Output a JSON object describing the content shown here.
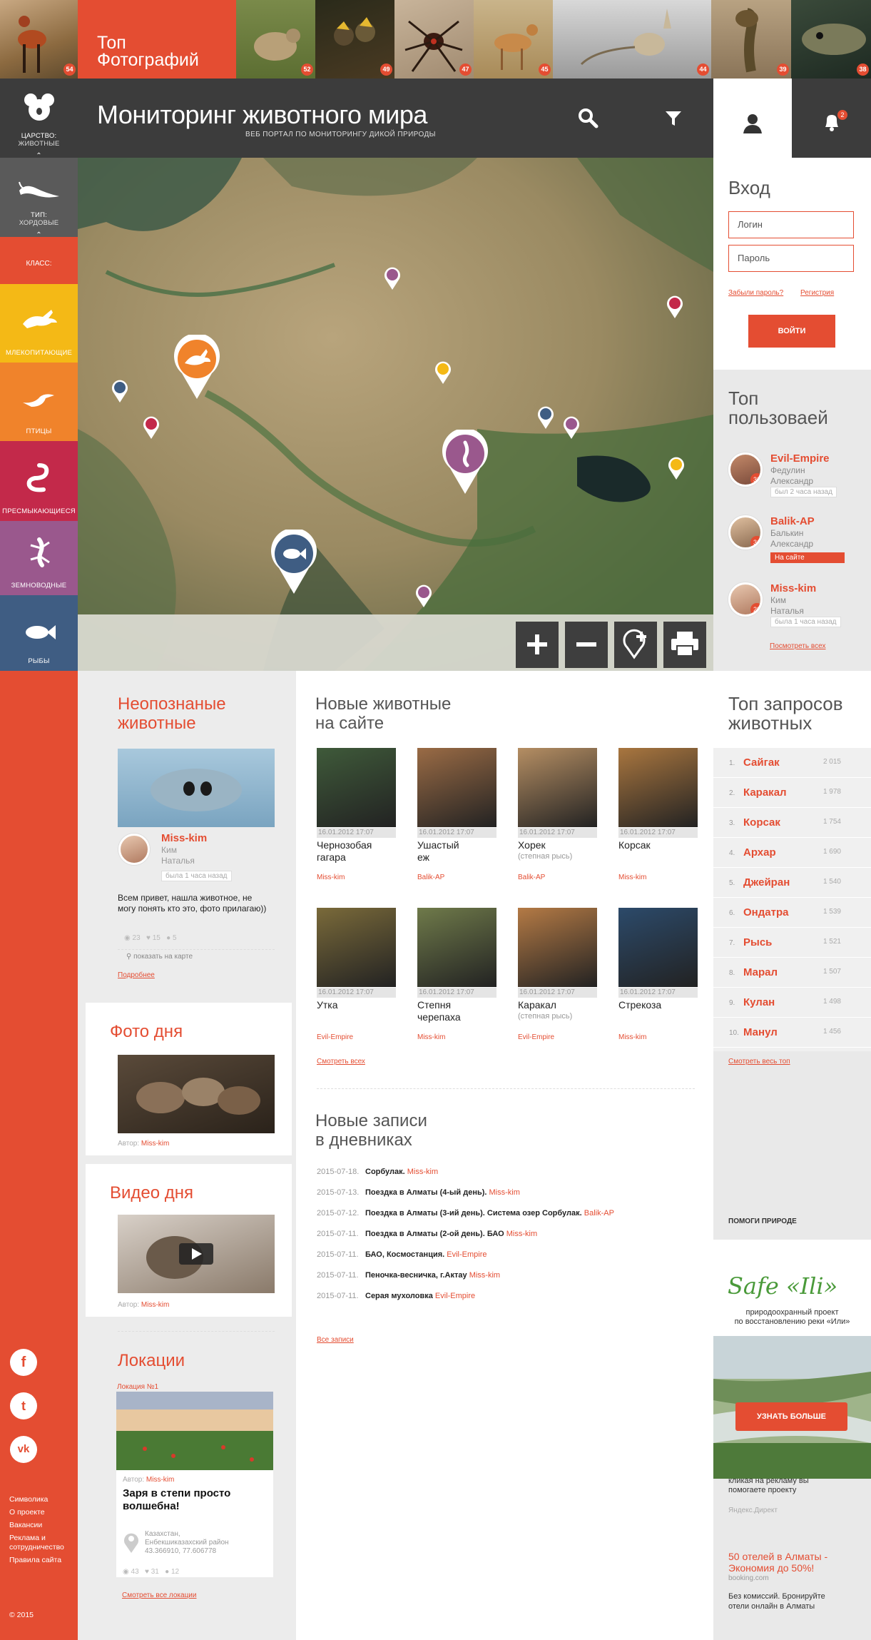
{
  "top_photos": {
    "title_line1": "Топ",
    "title_line2": "Фотографий",
    "counts": [
      "54",
      "52",
      "49",
      "47",
      "45",
      "44",
      "39",
      "38"
    ]
  },
  "nav": {
    "kingdom_label": "ЦАРСТВО:",
    "kingdom_value": "ЖИВОТНЫЕ",
    "type_label": "ТИП:",
    "type_value": "ХОРДОВЫЕ",
    "class_label": "КЛАСС:",
    "classes": [
      {
        "label": "МЛЕКОПИТАЮЩИЕ",
        "color": "#f4b916"
      },
      {
        "label": "ПТИЦЫ",
        "color": "#f0832b"
      },
      {
        "label": "ПРЕСМЫКАЮЩИЕСЯ",
        "color": "#c3294a"
      },
      {
        "label": "ЗЕМНОВОДНЫЕ",
        "color": "#9a588d"
      },
      {
        "label": "РЫБЫ",
        "color": "#3f5d83"
      }
    ]
  },
  "header": {
    "title": "Мониторинг животного мира",
    "subtitle": "ВЕБ ПОРТАЛ ПО МОНИТОРИНГУ ДИКОЙ ПРИРОДЫ",
    "notif_count": "2"
  },
  "login": {
    "title": "Вход",
    "login_placeholder": "Логин",
    "password_placeholder": "Пароль",
    "forgot": "Забыли пароль?",
    "register": "Регистрия",
    "submit": "ВОЙТИ"
  },
  "top_users": {
    "title_line1": "Топ",
    "title_line2": "пользоваей",
    "users": [
      {
        "nick": "Evil-Empire",
        "last": "Федулин",
        "first": "Александр",
        "score": "32",
        "status": "был 2 часа назад"
      },
      {
        "nick": "Balik-AP",
        "last": "Балькин",
        "first": "Александр",
        "score": "31",
        "status": "На сайте"
      },
      {
        "nick": "Miss-kim",
        "last": "Ким",
        "first": "Наталья",
        "score": "28",
        "status": "была 1 часа назад"
      }
    ],
    "all_link": "Посмотреть всех"
  },
  "top_queries": {
    "title_line1": "Топ запросов",
    "title_line2": "животных",
    "rows": [
      {
        "n": "1.",
        "q": "Сайгак",
        "c": "2 015"
      },
      {
        "n": "2.",
        "q": "Каракал",
        "c": "1 978"
      },
      {
        "n": "3.",
        "q": "Корсак",
        "c": "1 754"
      },
      {
        "n": "4.",
        "q": "Архар",
        "c": "1 690"
      },
      {
        "n": "5.",
        "q": "Джейран",
        "c": "1 540"
      },
      {
        "n": "6.",
        "q": "Ондатра",
        "c": "1 539"
      },
      {
        "n": "7.",
        "q": "Рысь",
        "c": "1 521"
      },
      {
        "n": "8.",
        "q": "Марал",
        "c": "1 507"
      },
      {
        "n": "9.",
        "q": "Кулан",
        "c": "1 498"
      },
      {
        "n": "10.",
        "q": "Манул",
        "c": "1 456"
      }
    ],
    "all_link": "Смотреть весь топ"
  },
  "help": {
    "label": "ПОМОГИ ПРИРОДЕ",
    "brand": "Safe «Ili»",
    "desc_line1": "природоохранный проект",
    "desc_line2": "по восстановлению реки «Или»",
    "button": "УЗНАТЬ БОЛЬШЕ"
  },
  "ads": {
    "note_line1": "кликая на рекламу вы",
    "note_line2": "помогаете проекту",
    "provider": "Яндекс.Директ",
    "ad_title_line1": "50 отелей в Алматы -",
    "ad_title_line2": "Экономия до 50%!",
    "ad_domain": "booking.com",
    "ad_text_line1": "Без комиссий. Бронируйте",
    "ad_text_line2": "отели онлайн в Алматы"
  },
  "unidentified": {
    "title_line1": "Неопознаные",
    "title_line2": "животные",
    "user": "Miss-kim",
    "last": "Ким",
    "first": "Наталья",
    "status": "была 1 часа назад",
    "text": "Всем привет, нашла животное, не могу понять кто это, фото прилагаю))",
    "views": "23",
    "likes": "15",
    "comments": "5",
    "map_link": "показать на карте",
    "more": "Подробнее"
  },
  "photo_day": {
    "title": "Фото дня",
    "author_label": "Автор:",
    "author": "Miss-kim"
  },
  "video_day": {
    "title": "Видео дня",
    "author_label": "Автор:",
    "author": "Miss-kim"
  },
  "locations": {
    "title": "Локации",
    "item_label": "Локация №1",
    "author_label": "Автор:",
    "author": "Miss-kim",
    "headline_line1": "Заря в степи просто",
    "headline_line2": "волшебна!",
    "place_line1": "Казахстан,",
    "place_line2": "Енбекшиказахский район",
    "coords": "43.366910, 77.606778",
    "views": "43",
    "likes": "31",
    "comments": "12",
    "all_link": "Смотреть все локации"
  },
  "new_animals": {
    "title_line1": "Новые животные",
    "title_line2": "на сайте",
    "items": [
      {
        "date": "16.01.2012 17:07",
        "name1": "Чернозобая",
        "name2": "гагара",
        "sub": "",
        "author": "Miss-kim",
        "bg": "#3f5a3a"
      },
      {
        "date": "16.01.2012 17:07",
        "name1": "Ушастый",
        "name2": "еж",
        "sub": "",
        "author": "Balik-AP",
        "bg": "#9a6b45"
      },
      {
        "date": "16.01.2012 17:07",
        "name1": "Хорек",
        "name2": "",
        "sub": "(степная рысь)",
        "author": "Balik-AP",
        "bg": "#b58e63"
      },
      {
        "date": "16.01.2012 17:07",
        "name1": "Корсак",
        "name2": "",
        "sub": "",
        "author": "Miss-kim",
        "bg": "#a9763f"
      },
      {
        "date": "16.01.2012 17:07",
        "name1": "Утка",
        "name2": "",
        "sub": "",
        "author": "Evil-Empire",
        "bg": "#7a6a3a"
      },
      {
        "date": "16.01.2012 17:07",
        "name1": "Степня",
        "name2": "черепаха",
        "sub": "",
        "author": "Miss-kim",
        "bg": "#6f7a4a"
      },
      {
        "date": "16.01.2012 17:07",
        "name1": "Каракал",
        "name2": "",
        "sub": "(степная рысь)",
        "author": "Evil-Empire",
        "bg": "#b47a45"
      },
      {
        "date": "16.01.2012 17:07",
        "name1": "Стрекоза",
        "name2": "",
        "sub": "",
        "author": "Miss-kim",
        "bg": "#2c4a6a"
      }
    ],
    "all_link": "Смотреть всех"
  },
  "diaries": {
    "title_line1": "Новые записи",
    "title_line2": "в дневниках",
    "entries": [
      {
        "date": "2015-07-18.",
        "title": "Сорбулак.",
        "author": "Miss-kim"
      },
      {
        "date": "2015-07-13.",
        "title": "Поездка в Алматы (4-ый день).",
        "author": "Miss-kim"
      },
      {
        "date": "2015-07-12.",
        "title": "Поездка в Алматы (3-ий день). Система озер Сорбулак.",
        "author": "Balik-AP"
      },
      {
        "date": "2015-07-11.",
        "title": "Поездка в Алматы (2-ой день). БАО",
        "author": "Miss-kim"
      },
      {
        "date": "2015-07-11.",
        "title": "БАО, Космостанция.",
        "author": "Evil-Empire"
      },
      {
        "date": "2015-07-11.",
        "title": "Пеночка-весничка, г.Актау",
        "author": "Miss-kim"
      },
      {
        "date": "2015-07-11.",
        "title": "Серая мухоловка",
        "author": "Evil-Empire"
      }
    ],
    "all_link": "Все записи"
  },
  "footer": {
    "links": [
      "Символика",
      "О проекте",
      "Вакансии",
      "Реклама и",
      "сотрудничество",
      "Правила сайта"
    ],
    "copyright": "© 2015",
    "social": [
      "f",
      "t",
      "vk"
    ]
  },
  "colors": {
    "accent": "#e44d32",
    "dark": "#3c3c3c"
  }
}
